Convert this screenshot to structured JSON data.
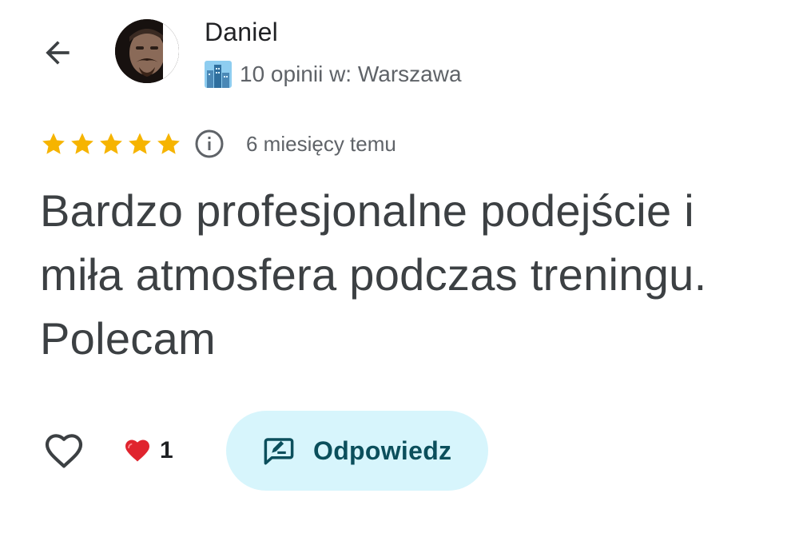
{
  "header": {
    "reviewer_name": "Daniel",
    "reviewer_meta": "10 opinii w: Warszawa"
  },
  "review": {
    "rating": 5,
    "max_rating": 5,
    "date": "6 miesięcy temu",
    "text": "Bardzo profesjonalne podejście i miła atmosfera podczas treningu. Polecam"
  },
  "actions": {
    "like_count": "1",
    "reply_label": "Odpowiedz"
  },
  "colors": {
    "star": "#f6b400",
    "reply_bg": "#d7f5fc",
    "reply_text": "#0b4f5c",
    "heart": "#e0242e"
  },
  "icons": {
    "back": "arrow-left-icon",
    "info": "info-icon",
    "like": "heart-outline-icon",
    "liked": "heart-filled-icon",
    "reply": "reply-edit-icon",
    "city": "city-emoji-icon"
  }
}
